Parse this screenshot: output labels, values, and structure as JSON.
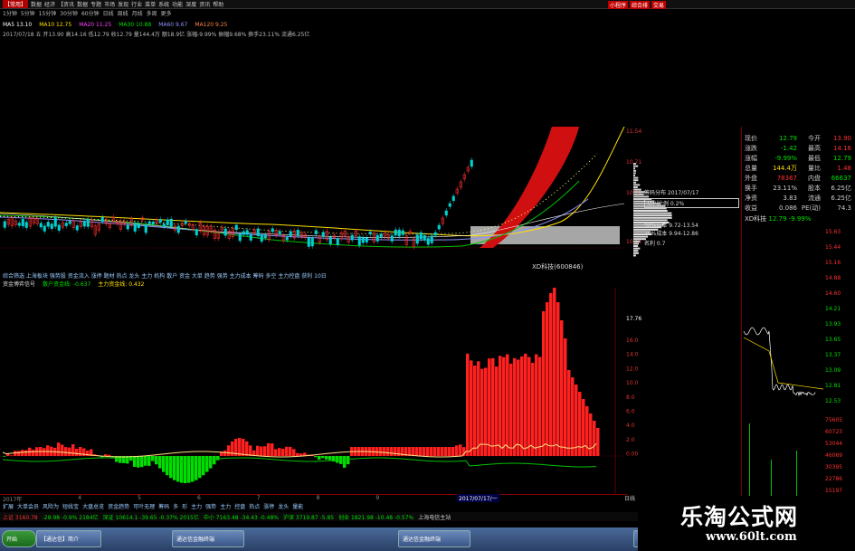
{
  "menu": [
    "【常用】",
    "数据",
    "经济",
    "【资讯",
    "数据",
    "专题",
    "市场",
    "发现",
    "行业",
    "菜单",
    "系统",
    "功能",
    "深度",
    "资讯",
    "帮助"
  ],
  "period": [
    "1分钟",
    "5分钟",
    "15分钟",
    "30分钟",
    "60分钟",
    "日线",
    "周线",
    "月线",
    "多周",
    "更多"
  ],
  "top_buttons": [
    "小程序",
    "综合排",
    "交易"
  ],
  "ma_line": [
    {
      "text": "MA5 13.10",
      "color": "#ffffff"
    },
    {
      "text": "MA10 12.75",
      "color": "#ffe000"
    },
    {
      "text": "MA20 11.25",
      "color": "#ff40ff"
    },
    {
      "text": "MA30 10.88",
      "color": "#00e000"
    },
    {
      "text": "MA60 9.67",
      "color": "#9090ff"
    },
    {
      "text": "MA120 9.25",
      "color": "#ff8040"
    }
  ],
  "info_line": "2017/07/18 五 开13.90 高14.16 低12.79 收12.79 量144.4万 额18.9亿 涨幅-9.99% 振幅9.68% 换手23.11% 流通6.25亿",
  "indicator_line": "综合筛选 上海板块 强势股 资金流入 涨停 题材 热点 龙头 主力 机构 散户 资金 大单 趋势 强势 主力成本 筹码 多空 主力控盘 获利 10日",
  "indicator_line2": [
    {
      "text": "资金博弈信号",
      "color": "#dddddd"
    },
    {
      "text": "散户资金线: -0.637",
      "color": "#00e000"
    },
    {
      "text": "主力资金线: 0.432",
      "color": "#ffe000"
    }
  ],
  "stock_label": "XD科技(600846)",
  "cost_box": {
    "title": "筹码分布 2017/07/17",
    "rows": [
      "获利比例 0.2%",
      "90%成本 9.72-13.54",
      "70%成本 9.94-12.86"
    ],
    "pct": "名利 0.7"
  },
  "right_axis_main": [
    "11.54",
    "10.71",
    "10.29",
    "10.11"
  ],
  "right_axis_ind": [
    "17.76",
    "16.0",
    "14.0",
    "12.0",
    "10.0",
    "8.0",
    "6.0",
    "4.0",
    "2.0",
    "0.00"
  ],
  "bottom_dates": [
    "2017年",
    "4",
    "5",
    "6",
    "7",
    "8",
    "9"
  ],
  "bottom_date_hl": "2017/07/17/一",
  "bottom_right_tab": "日线",
  "tabs": [
    "扩展",
    "大单会员",
    "风险为",
    "短线宝",
    "大盘总览",
    "资金趋势",
    "可叶无理",
    "筹码",
    "多",
    "形",
    "主力",
    "强势",
    "主力",
    "控盘",
    "热点",
    "涨停",
    "龙头",
    "量能"
  ],
  "status": [
    {
      "text": "上证 3160.78",
      "color": "#ff3030"
    },
    {
      "text": "-28.98 -0.9% 2184亿",
      "color": "#00e000"
    },
    {
      "text": "深证 10614.1 -39.65 -0.37% 2015亿",
      "color": "#00e000"
    },
    {
      "text": "中小 7163.48 -34.43 -0.48%",
      "color": "#00e000"
    },
    {
      "text": "沪深 3719.87 -5.85",
      "color": "#00e000"
    },
    {
      "text": "创业 1821.98 -10.48 -0.57%",
      "color": "#00e000"
    },
    {
      "text": "上海电信主站",
      "color": "#cccccc"
    }
  ],
  "quote_panel": {
    "rows": [
      {
        "label": "现价",
        "v1": "12.79",
        "l2": "今开",
        "v2": "13.90",
        "c1": "#00e000",
        "c2": "#ff3030"
      },
      {
        "label": "涨跌",
        "v1": "-1.42",
        "l2": "最高",
        "v2": "14.16",
        "c1": "#00e000",
        "c2": "#ff3030"
      },
      {
        "label": "涨幅",
        "v1": "-9.99%",
        "l2": "最低",
        "v2": "12.79",
        "c1": "#00e000",
        "c2": "#00e000"
      },
      {
        "label": "总量",
        "v1": "144.4万",
        "l2": "量比",
        "v2": "1.48",
        "c1": "#ffe000",
        "c2": "#ff3030"
      },
      {
        "label": "外盘",
        "v1": "78367",
        "l2": "内盘",
        "v2": "66637",
        "c1": "#ff3030",
        "c2": "#00e000"
      },
      {
        "label": "换手",
        "v1": "23.11%",
        "l2": "股本",
        "v2": "6.25亿",
        "c1": "#cccccc",
        "c2": "#cccccc"
      },
      {
        "label": "净资",
        "v1": "3.83",
        "l2": "流通",
        "v2": "6.25亿",
        "c1": "#cccccc",
        "c2": "#cccccc"
      },
      {
        "label": "收益",
        "v1": "0.086",
        "l2": "PE(动)",
        "v2": "74.3",
        "c1": "#cccccc",
        "c2": "#cccccc"
      }
    ],
    "mini_title": "XD科技",
    "mini_values": "12.79 -9.99%",
    "price_axis": [
      "15.63",
      "15.44",
      "15.16",
      "14.88",
      "14.60",
      "14.21",
      "13.93",
      "13.65",
      "13.37",
      "13.09",
      "12.81",
      "12.53"
    ],
    "vol_axis": [
      "75605",
      "60723",
      "53044",
      "46069",
      "30395",
      "22786",
      "15197",
      "7598"
    ]
  },
  "taskbar": [
    "开始",
    "【通达信】简介",
    "通达信金融终端",
    "通达信金融终端",
    "桌面"
  ],
  "watermark": {
    "title": "乐淘公式网",
    "url": "www.60lt.com"
  },
  "chart_data": {
    "type": "bar",
    "title": "",
    "series": [
      {
        "name": "主力资金线",
        "color": "#ff2020"
      },
      {
        "name": "散户资金线",
        "color": "#00e000"
      }
    ]
  }
}
